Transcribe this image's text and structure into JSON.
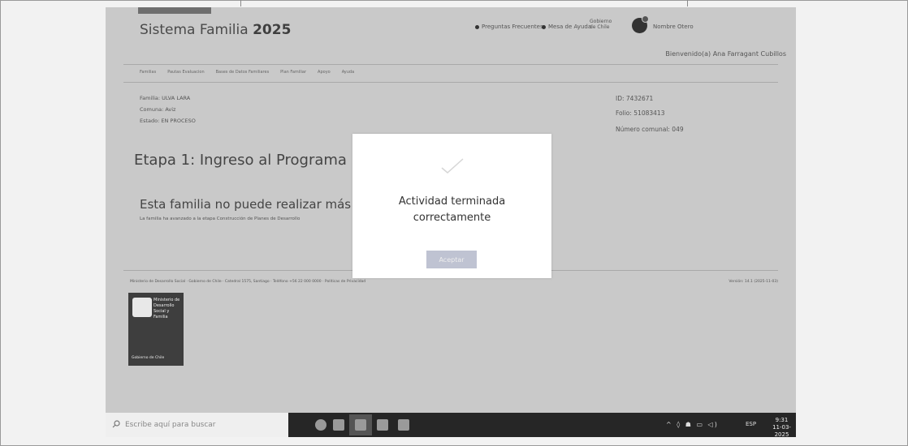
{
  "header": {
    "app_title_prefix": "Sistema Familia",
    "app_title_year": "2025",
    "link_faq": "Preguntas Frecuentes",
    "link_help": "Mesa de Ayuda",
    "gov_label": "Gobierno de Chile",
    "user_short": "Nombre Otero",
    "welcome": "Bienvenido(a) Ana Farragant Cubillos"
  },
  "nav": {
    "items": [
      "Familias",
      "Pautas Evaluacion",
      "Bases de Datos Familiares",
      "Plan Familiar",
      "Apoyo",
      "Ayuda"
    ]
  },
  "family_info": {
    "line1": "Familia: ULVA LARA",
    "line2": "Comuna: Aviz",
    "line3": "Estado: EN PROCESO",
    "id_label": "ID: 7432671",
    "folio_label": "Folio: 51083413",
    "number_label": "Número comunal: 049"
  },
  "main": {
    "stage_title": "Etapa 1: Ingreso al Programa",
    "family_message": "Esta familia no puede realizar más sesiones",
    "family_sub": "La familia ha avanzado a la etapa Construcción de Planes de Desarrollo"
  },
  "footer": {
    "address": "Ministerio de Desarrollo Social · Gobierno de Chile · Catedral 1575, Santiago · Teléfono +56 22 000 0000 · Políticas de Privacidad",
    "version": "Versión: 14.1 (2025-11-03)",
    "ministry_label": "Ministerio de Desarrollo Social y Familia",
    "gobierno_label": "Gobierno de Chile"
  },
  "taskbar": {
    "search_placeholder": "Escribe aquí para buscar",
    "tray": "^ ◊ ☗ ▭ ◁)",
    "lang": "ESP",
    "time": "9:31",
    "date": "11-03-2025"
  },
  "modal": {
    "message_line1": "Actividad terminada",
    "message_line2": "correctamente",
    "button_label": "Aceptar"
  },
  "colors": {
    "modal_button": "#bfc3d2",
    "screen_background": "#c9c9c9",
    "taskbar": "#262626"
  }
}
